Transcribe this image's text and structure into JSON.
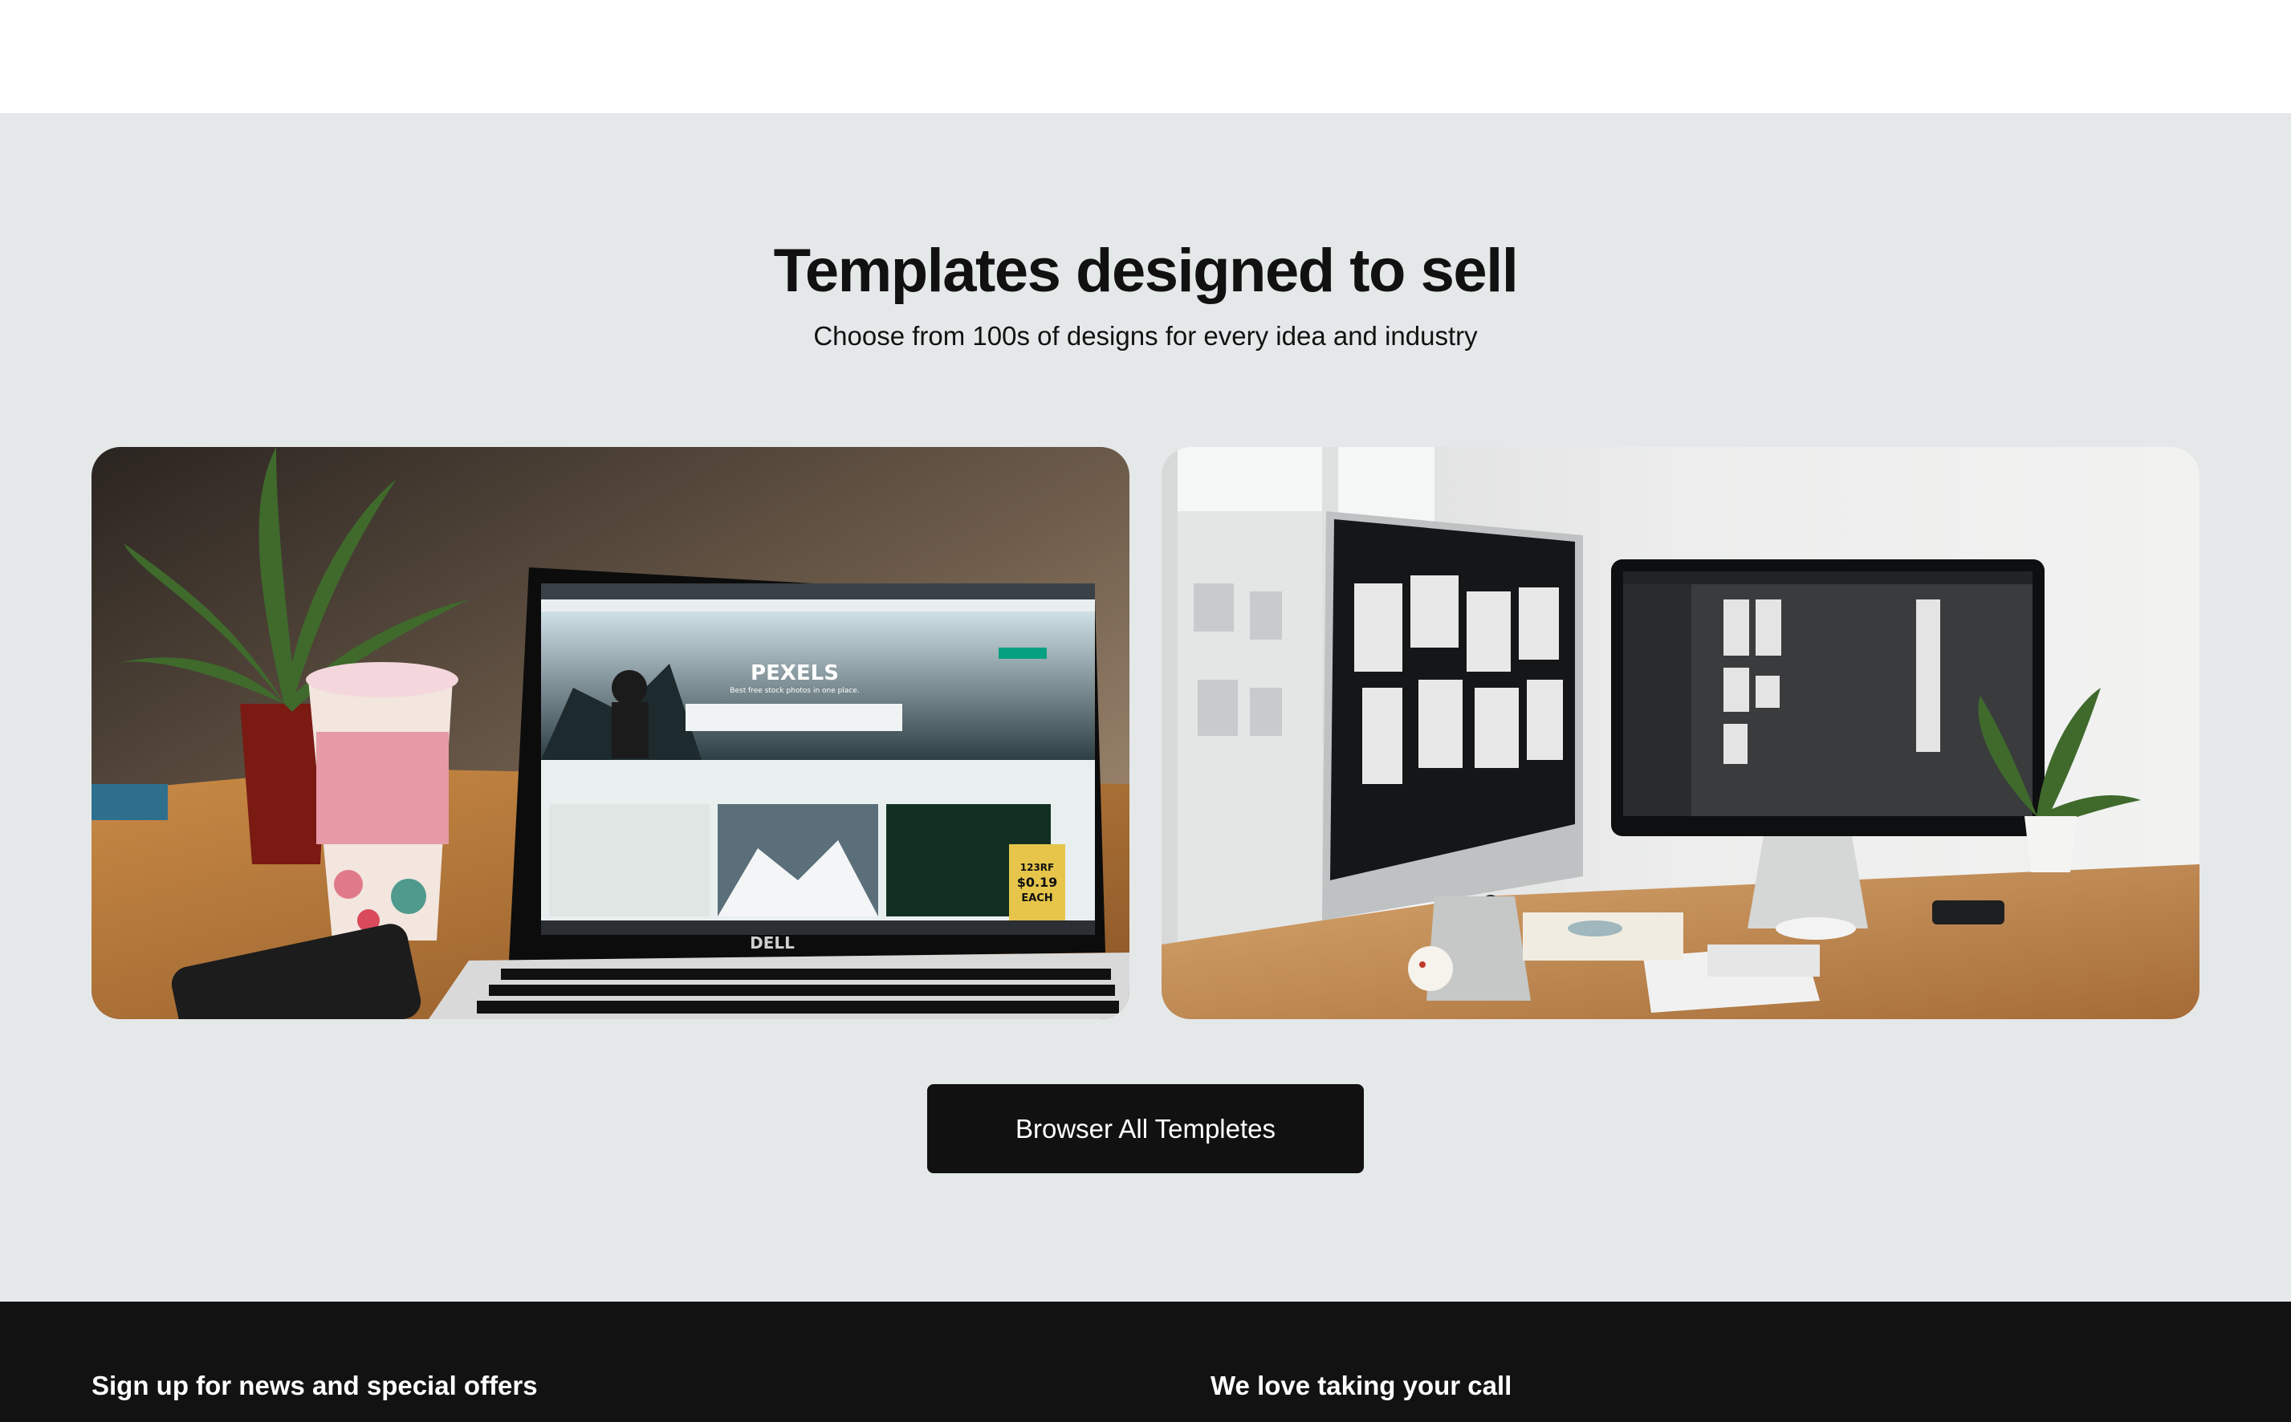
{
  "templates": {
    "title": "Templates designed to sell",
    "subtitle": "Choose from 100s of designs for every idea and industry",
    "cards": [
      {
        "image": "laptop-desk-photo",
        "screen_brand": "PEXELS",
        "screen_tagline": "Best free stock photos in one place.",
        "laptop_brand": "DELL",
        "ad_brand": "123RF",
        "ad_price": "$0.19",
        "ad_unit": "EACH"
      },
      {
        "image": "dual-monitor-desk-photo"
      }
    ],
    "browse_label": "Browser All Templetes"
  },
  "footer": {
    "signup_heading": "Sign up for news and special offers",
    "contact_heading": "We love taking your call"
  },
  "colors": {
    "section_background": "#e5e8e9",
    "button_background": "#111111",
    "footer_background": "#121212",
    "text_primary": "#111111"
  }
}
